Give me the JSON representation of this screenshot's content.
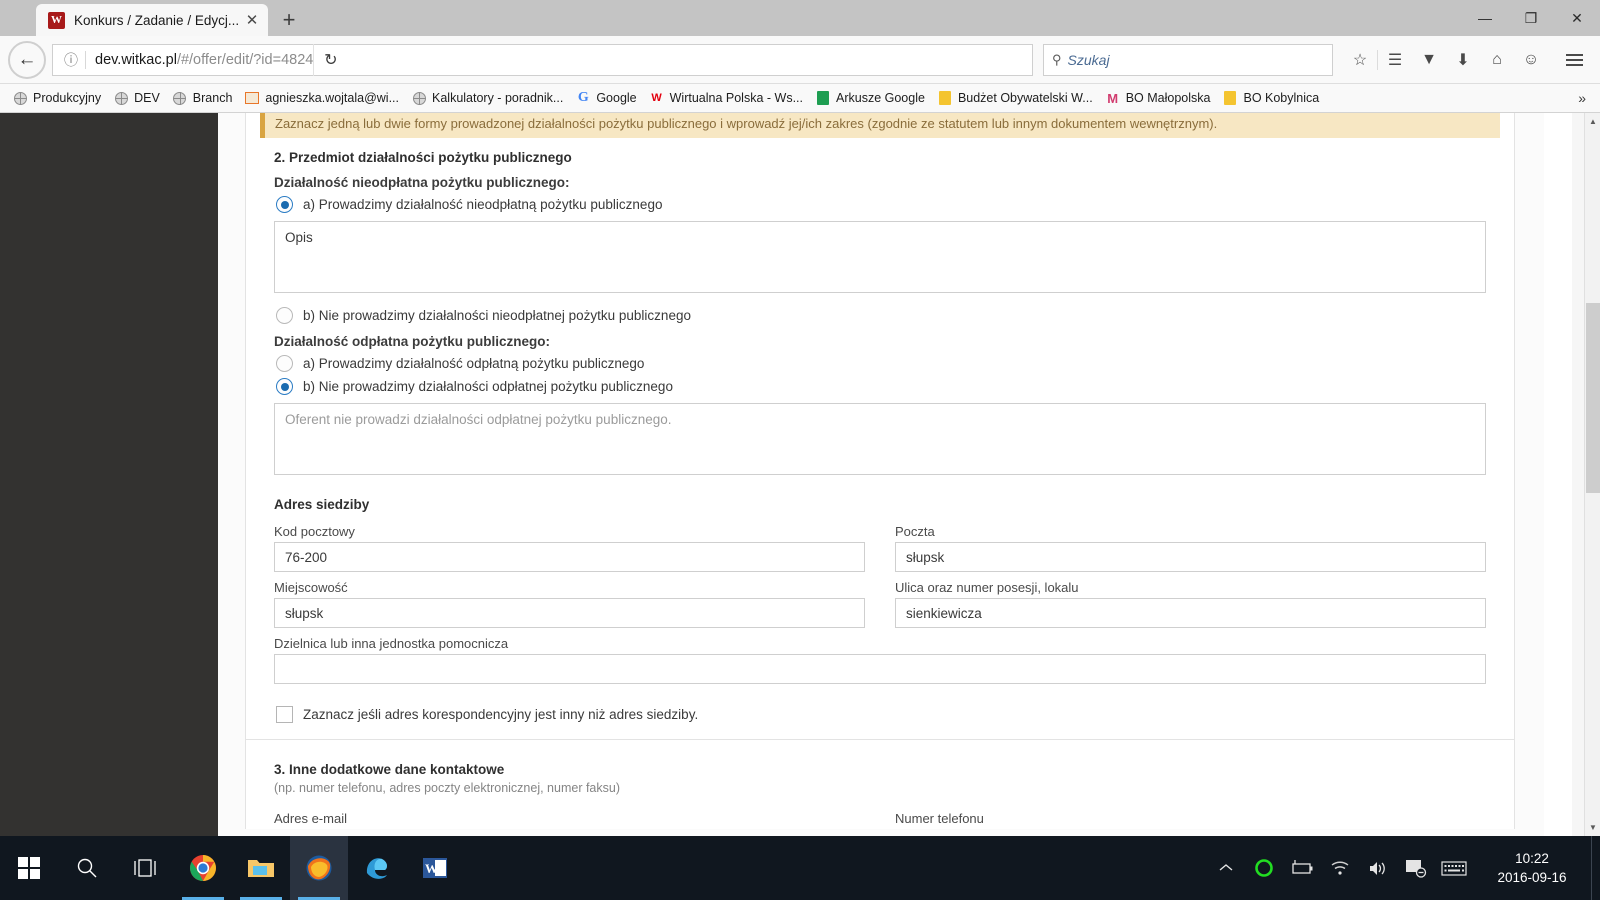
{
  "browser": {
    "tab": {
      "title": "Konkurs / Zadanie / Edycj...",
      "favicon_letter": "W",
      "close_icon": "✕"
    },
    "new_tab_icon": "+",
    "window_controls": {
      "minimize": "—",
      "maximize": "❐",
      "close": "✕"
    },
    "nav": {
      "back_icon": "←",
      "identity_icon": "ⓘ",
      "url_host": "dev.witkac.pl",
      "url_path": "/#/offer/edit/?id=4824",
      "reload_icon": "↻"
    },
    "search": {
      "icon": "⚲",
      "placeholder": "Szukaj"
    },
    "toolbar_icons": [
      {
        "name": "bookmark-star-icon",
        "glyph": "☆"
      },
      {
        "name": "reading-list-icon",
        "glyph": "☰"
      },
      {
        "name": "pocket-icon",
        "glyph": "▼"
      },
      {
        "name": "downloads-icon",
        "glyph": "⬇"
      },
      {
        "name": "home-icon",
        "glyph": "⌂"
      },
      {
        "name": "account-icon",
        "glyph": "☺"
      }
    ],
    "bookmarks": [
      {
        "label": "Produkcyjny",
        "icon": "globe"
      },
      {
        "label": "DEV",
        "icon": "globe"
      },
      {
        "label": "Branch",
        "icon": "globe"
      },
      {
        "label": "agnieszka.wojtala@wi...",
        "icon": "mail"
      },
      {
        "label": "Kalkulatory - poradnik...",
        "icon": "globe"
      },
      {
        "label": "Google",
        "icon": "google"
      },
      {
        "label": "Wirtualna Polska - Ws...",
        "icon": "wp"
      },
      {
        "label": "Arkusze Google",
        "icon": "sheets"
      },
      {
        "label": "Budżet Obywatelski W...",
        "icon": "keep"
      },
      {
        "label": "BO Małopolska",
        "icon": "chart"
      },
      {
        "label": "BO Kobylnica",
        "icon": "keep"
      }
    ],
    "bookmarks_overflow_icon": "»"
  },
  "page": {
    "alert": "Zaznacz jedną lub dwie formy prowadzonej działalności pożytku publicznego i wprowadź jej/ich zakres (zgodnie ze statutem lub innym dokumentem wewnętrznym).",
    "section2_title": "2. Przedmiot działalności pożytku publicznego",
    "nieodplatna": {
      "label": "Działalność nieodpłatna pożytku publicznego:",
      "option_a": "a) Prowadzimy działalność nieodpłatną pożytku publicznego",
      "option_b": "b) Nie prowadzimy działalności nieodpłatnej pożytku publicznego",
      "selected": "a",
      "textarea_value": "Opis"
    },
    "odplatna": {
      "label": "Działalność odpłatna pożytku publicznego:",
      "option_a": "a) Prowadzimy działalność odpłatną pożytku publicznego",
      "option_b": "b) Nie prowadzimy działalności odpłatnej pożytku publicznego",
      "selected": "b",
      "textarea_placeholder": "Oferent nie prowadzi działalności odpłatnej pożytku publicznego."
    },
    "adres": {
      "title": "Adres siedziby",
      "kod_pocztowy": {
        "label": "Kod pocztowy",
        "value": "76-200"
      },
      "poczta": {
        "label": "Poczta",
        "value": "słupsk"
      },
      "miejscowosc": {
        "label": "Miejscowość",
        "value": "słupsk"
      },
      "ulica": {
        "label": "Ulica oraz numer posesji, lokalu",
        "value": "sienkiewicza"
      },
      "dzielnica": {
        "label": "Dzielnica lub inna jednostka pomocnicza",
        "value": ""
      },
      "korespondencyjny_checkbox": "Zaznacz jeśli adres korespondencyjny jest inny niż adres siedziby.",
      "korespondencyjny_checked": false
    },
    "section3": {
      "title": "3. Inne dodatkowe dane kontaktowe",
      "hint": "(np. numer telefonu, adres poczty elektronicznej, numer faksu)",
      "email_label": "Adres e-mail",
      "phone_label": "Numer telefonu"
    },
    "scroll": {
      "up_arrow": "▲",
      "down_arrow": "▼"
    }
  },
  "taskbar": {
    "start_label": "Start",
    "search_icon": "⚲",
    "taskview_icon": "❑",
    "apps": [
      {
        "name": "chrome",
        "running": true,
        "active": false
      },
      {
        "name": "explorer",
        "running": true,
        "active": false
      },
      {
        "name": "firefox",
        "running": true,
        "active": true
      },
      {
        "name": "edge",
        "running": false,
        "active": false
      },
      {
        "name": "word",
        "running": false,
        "active": false
      }
    ],
    "tray": {
      "chevron": "^",
      "shield_color": "#22dd22",
      "battery_icon": "battery",
      "wifi_icon": "wifi",
      "volume_icon": "🔊",
      "action_center_icon": "notifications",
      "keyboard_icon": "keyboard"
    },
    "clock": {
      "time": "10:22",
      "date": "2016-09-16"
    }
  },
  "colors": {
    "accent_blue": "#1a6bb0",
    "alert_bg": "#f7e7c3",
    "alert_border": "#d9a441",
    "alert_text": "#8a6d3b",
    "sidebar_dark": "#333230",
    "taskbar": "#10171f"
  }
}
